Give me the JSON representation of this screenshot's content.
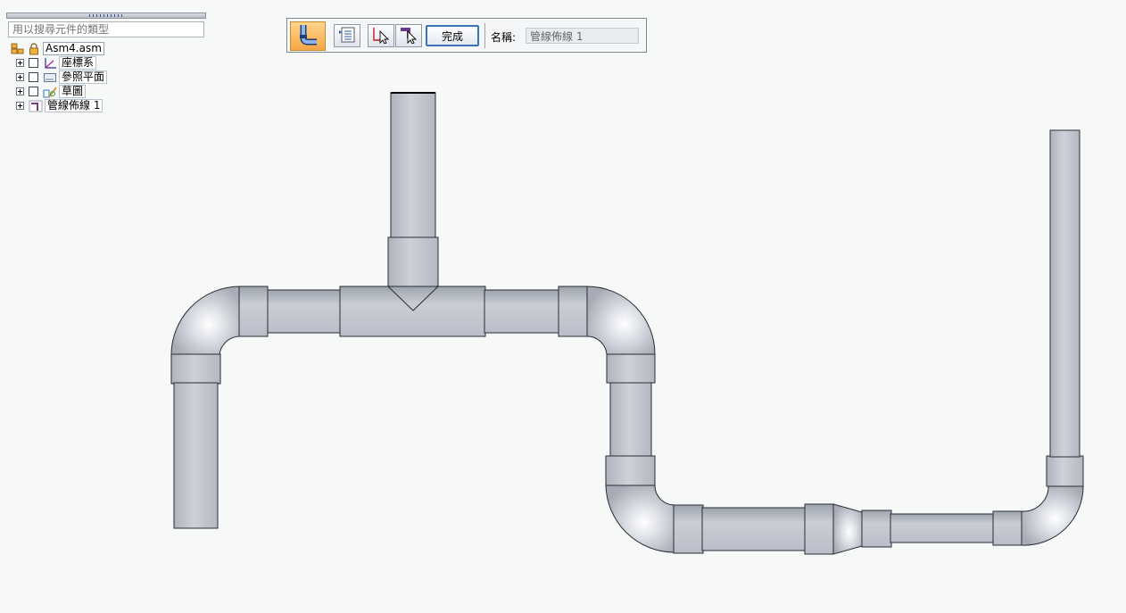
{
  "navigator": {
    "search_placeholder": "用以搜尋元件的類型",
    "root_label": "Asm4.asm",
    "items": [
      {
        "label": "座標系",
        "icon": "coordinate-system-icon"
      },
      {
        "label": "參照平面",
        "icon": "reference-plane-icon"
      },
      {
        "label": "草圖",
        "icon": "sketch-icon"
      },
      {
        "label": "管線佈線 1",
        "icon": "pipe-routing-icon"
      }
    ]
  },
  "command_bar": {
    "done_label": "完成",
    "name_label": "名稱:",
    "name_value": "管線佈線 1"
  },
  "colors": {
    "pipe_fill": "#c3c8d1",
    "pipe_edge": "#2a2d33",
    "background": "#f7f9f8",
    "active_button": "#f7a645"
  }
}
